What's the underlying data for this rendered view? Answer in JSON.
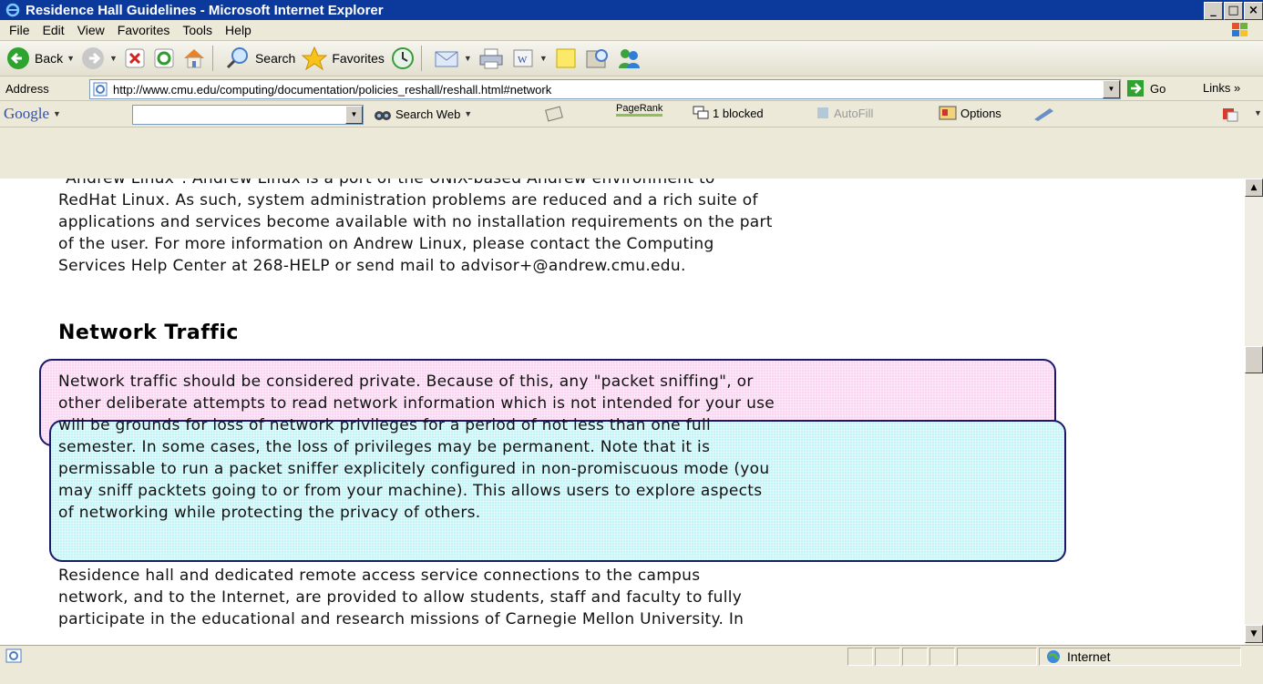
{
  "window": {
    "title": "Residence Hall Guidelines - Microsoft Internet Explorer",
    "buttons": {
      "minimize": "_",
      "maximize": "□",
      "close": "×"
    }
  },
  "menu": [
    "File",
    "Edit",
    "View",
    "Favorites",
    "Tools",
    "Help"
  ],
  "toolbar": {
    "back": "Back",
    "search": "Search",
    "favorites": "Favorites"
  },
  "address": {
    "label": "Address",
    "url": "http://www.cmu.edu/computing/documentation/policies_reshall/reshall.html#network",
    "go": "Go",
    "links": "Links »"
  },
  "google_bar": {
    "logo": "Google",
    "search_web": "Search Web",
    "pagerank": "PageRank",
    "blocked": "1 blocked",
    "autofill": "AutoFill",
    "options": "Options"
  },
  "content": {
    "intro_lines": [
      "\"Andrew Linux\": Andrew Linux is a port of the UNIX-based Andrew environment to",
      "RedHat Linux. As such, system administration problems are reduced and a rich suite of",
      "applications and services become available with no installation requirements on the part",
      "of the user. For more information on Andrew Linux, please contact the Computing",
      "Services Help Center at 268-HELP or send mail to advisor+@andrew.cmu.edu."
    ],
    "heading": "Network Traffic",
    "traffic_lines": [
      "Network traffic should be considered private. Because of this, any \"packet sniffing\", or",
      "other deliberate attempts to read network information which is not intended for your use",
      "will be grounds for loss of network privileges for a period of not less than one full",
      "semester. In some cases, the loss of privileges may be permanent. Note that it is",
      "permissable to run a packet sniffer explicitely configured in non-promiscuous mode (you",
      "may sniff packtets going to or from your machine). This allows users to explore aspects",
      "of networking while protecting the privacy of others."
    ],
    "residence_lines": [
      "Residence hall and dedicated remote access service connections to the campus",
      "network, and to the Internet, are provided to allow students, staff and faculty to fully",
      "participate in the educational and research missions of Carnegie Mellon University. In"
    ]
  },
  "status": {
    "zone": "Internet"
  },
  "colors": {
    "highlight_pink": "#fbd6f3",
    "highlight_cyan": "#c6f5f7",
    "highlight_border": "#1a1a6a",
    "titlebar": "#0b3a9c"
  }
}
